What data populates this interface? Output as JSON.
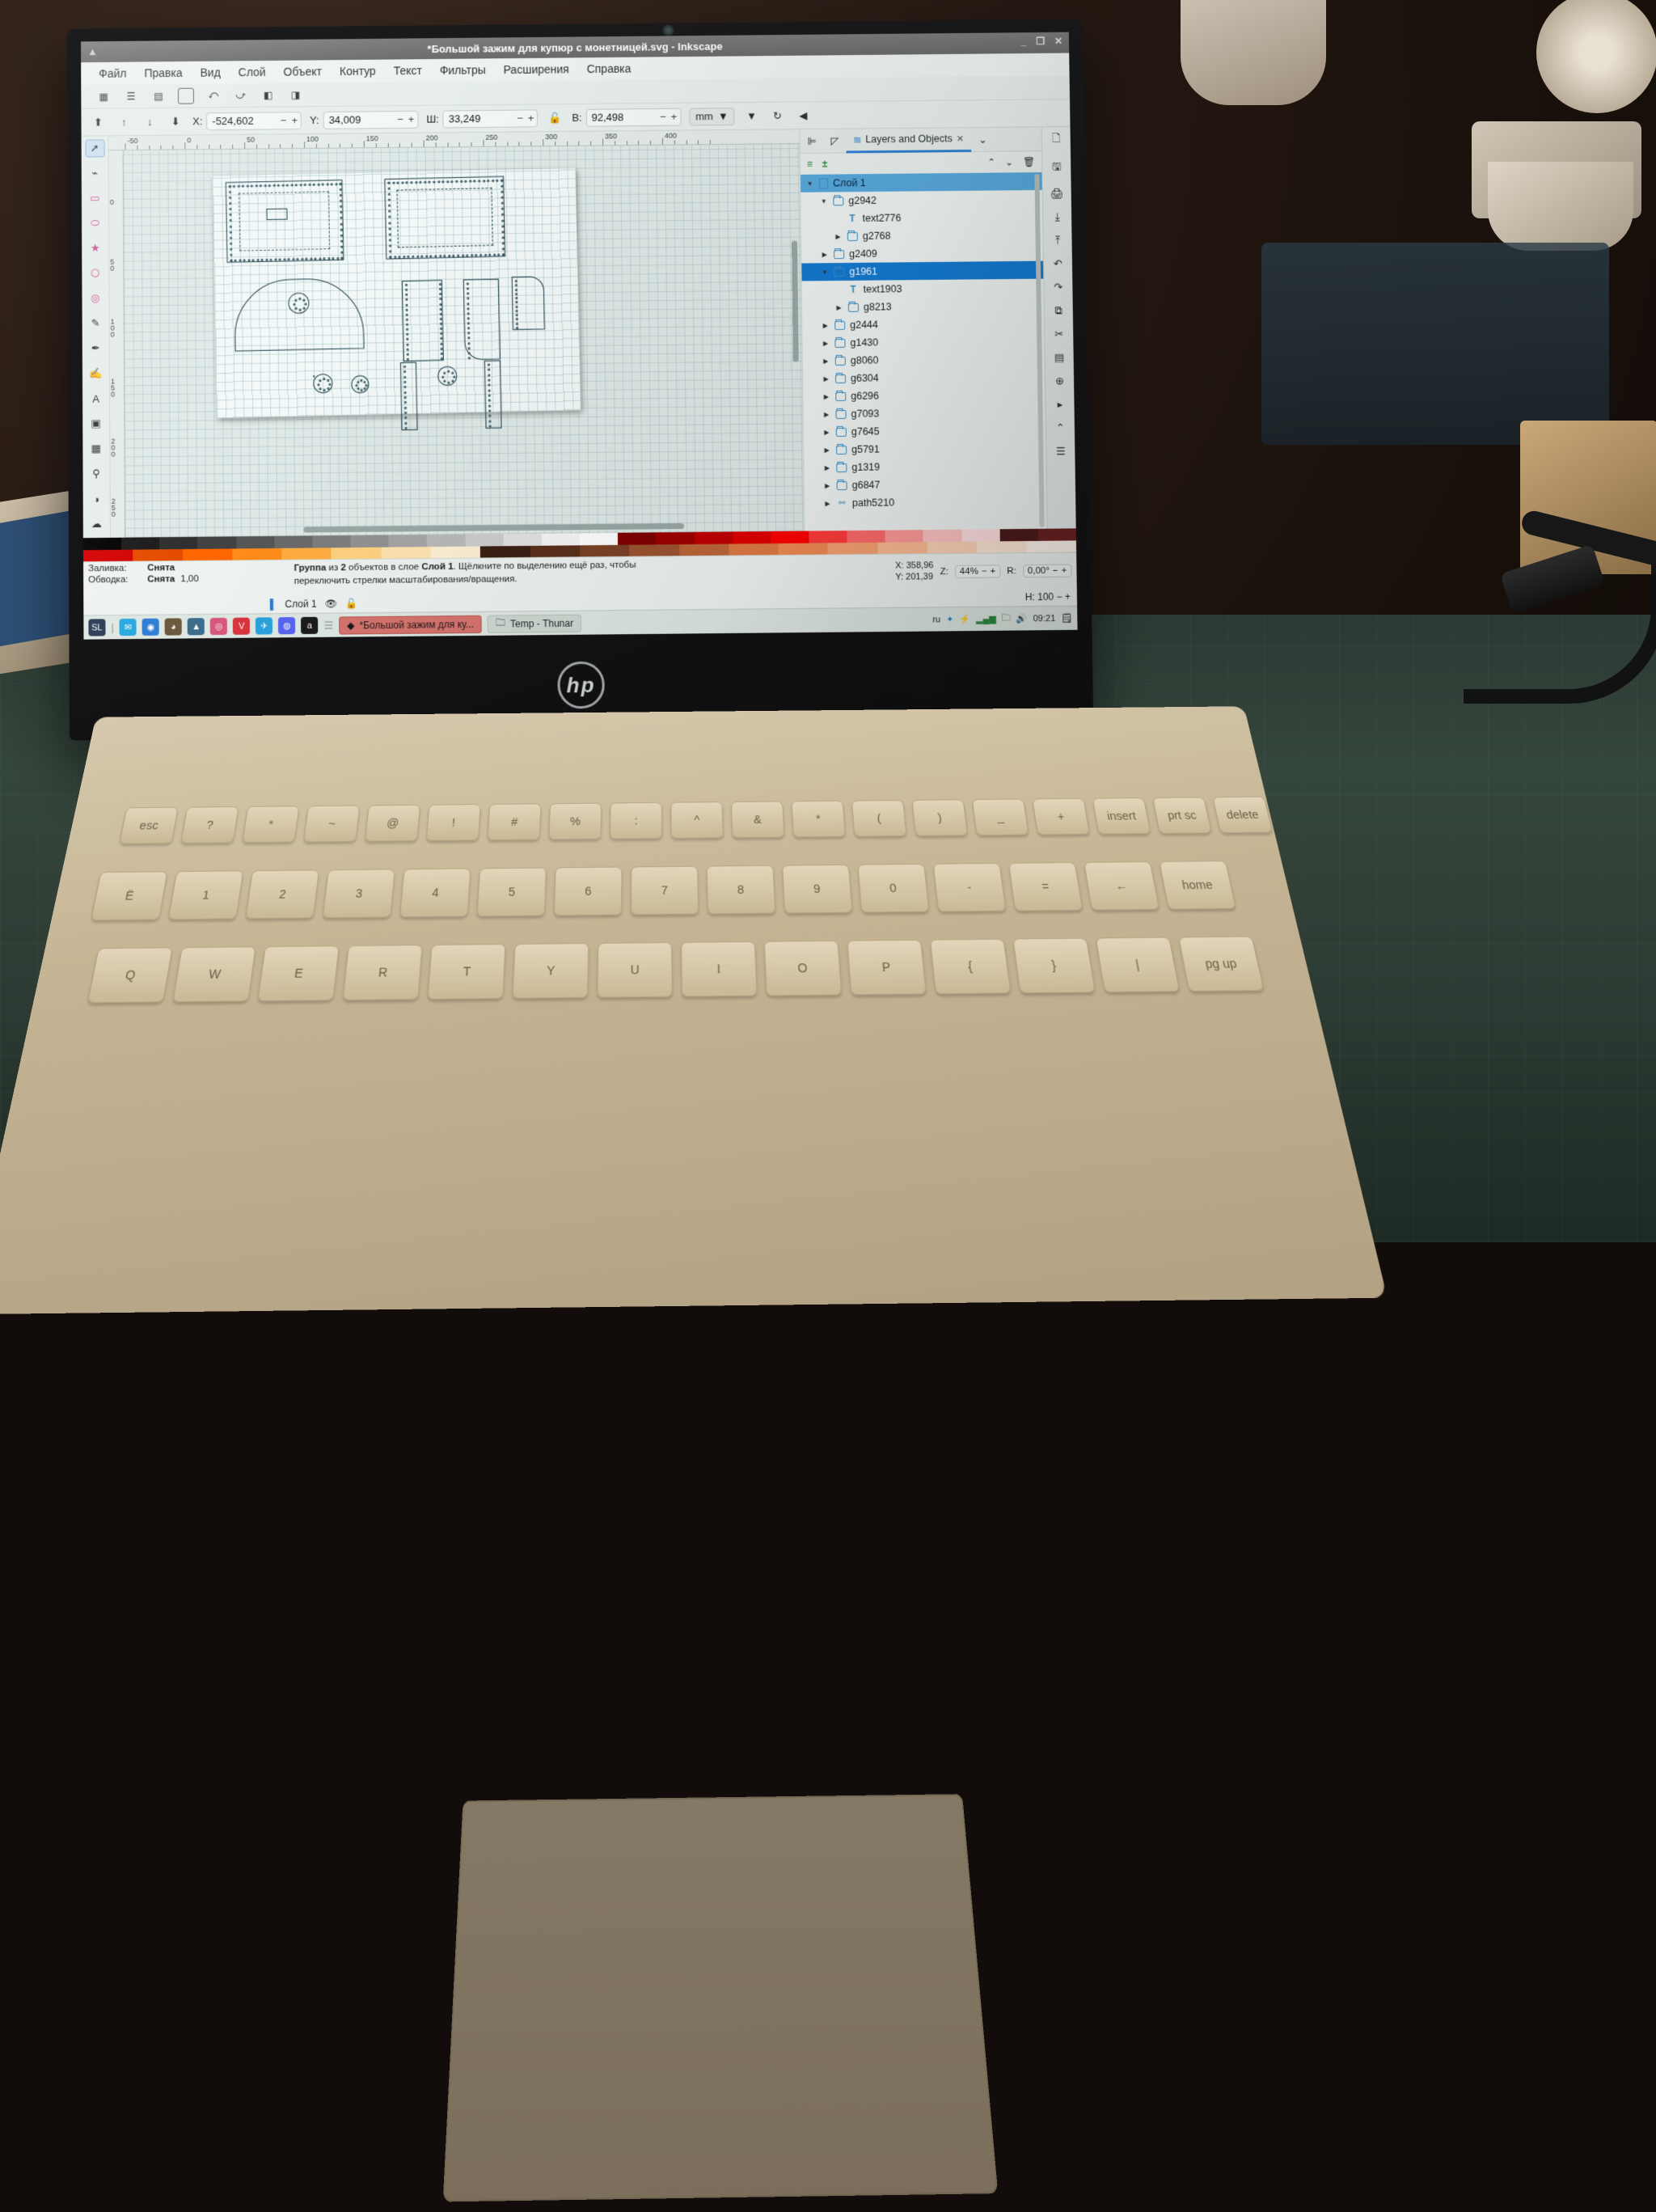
{
  "window": {
    "title": "*Большой зажим для купюр с монетницей.svg - Inkscape",
    "btn_minimize": "_",
    "btn_maximize": "❐",
    "btn_close": "✕",
    "collapse_arrow": "▲"
  },
  "menu": [
    "Файл",
    "Правка",
    "Вид",
    "Слой",
    "Объект",
    "Контур",
    "Текст",
    "Фильтры",
    "Расширения",
    "Справка"
  ],
  "toolbar": {
    "x_label": "X:",
    "x_value": "-524,602",
    "y_label": "Y:",
    "y_value": "34,009",
    "w_label": "Ш:",
    "w_value": "33,249",
    "h_label": "B:",
    "h_value": "92,498",
    "units": "mm",
    "minus": "−",
    "plus": "+",
    "lock_icon": "🔓",
    "overflow_arrow": "▼",
    "rotate_icon": "↻",
    "panel_arrow": "◀"
  },
  "rulers": {
    "h_ticks": [
      "-50",
      "0",
      "50",
      "100",
      "150",
      "200",
      "250",
      "300",
      "350",
      "400"
    ],
    "v_ticks": [
      "0",
      "50",
      "100",
      "150",
      "200",
      "250"
    ]
  },
  "dock": {
    "tabs": [
      {
        "label": "",
        "icon": "align-icon",
        "active": false
      },
      {
        "label": "",
        "icon": "pencil-icon",
        "active": false
      },
      {
        "label": "Layers and Objects",
        "icon": "layers-icon",
        "active": true,
        "close": "✕"
      }
    ],
    "chevron": "⌄",
    "tools": {
      "new_layer_icon": "≡",
      "add_layer_icon": "±",
      "move_up_icon": "⌃",
      "move_down_icon": "⌄",
      "delete_icon": "🗑"
    },
    "tree": [
      {
        "label": "Слой 1",
        "depth": 0,
        "type": "layer",
        "expanded": true,
        "selected": "light"
      },
      {
        "label": "g2942",
        "depth": 1,
        "type": "group",
        "expanded": true,
        "selected": "none"
      },
      {
        "label": "text2776",
        "depth": 2,
        "type": "text",
        "expanded": null,
        "selected": "none"
      },
      {
        "label": "g2768",
        "depth": 2,
        "type": "group",
        "expanded": false,
        "selected": "none"
      },
      {
        "label": "g2409",
        "depth": 1,
        "type": "group",
        "expanded": false,
        "selected": "none"
      },
      {
        "label": "g1961",
        "depth": 1,
        "type": "group",
        "expanded": true,
        "selected": "strong"
      },
      {
        "label": "text1903",
        "depth": 2,
        "type": "text",
        "expanded": null,
        "selected": "none"
      },
      {
        "label": "g8213",
        "depth": 2,
        "type": "group",
        "expanded": false,
        "selected": "none"
      },
      {
        "label": "g2444",
        "depth": 1,
        "type": "group",
        "expanded": false,
        "selected": "none"
      },
      {
        "label": "g1430",
        "depth": 1,
        "type": "group",
        "expanded": false,
        "selected": "none"
      },
      {
        "label": "g8060",
        "depth": 1,
        "type": "group",
        "expanded": false,
        "selected": "none"
      },
      {
        "label": "g6304",
        "depth": 1,
        "type": "group",
        "expanded": false,
        "selected": "none"
      },
      {
        "label": "g6296",
        "depth": 1,
        "type": "group",
        "expanded": false,
        "selected": "none"
      },
      {
        "label": "g7093",
        "depth": 1,
        "type": "group",
        "expanded": false,
        "selected": "none"
      },
      {
        "label": "g7645",
        "depth": 1,
        "type": "group",
        "expanded": false,
        "selected": "none"
      },
      {
        "label": "g5791",
        "depth": 1,
        "type": "group",
        "expanded": false,
        "selected": "none"
      },
      {
        "label": "g1319",
        "depth": 1,
        "type": "group",
        "expanded": false,
        "selected": "none"
      },
      {
        "label": "g6847",
        "depth": 1,
        "type": "group",
        "expanded": false,
        "selected": "none"
      },
      {
        "label": "path5210",
        "depth": 1,
        "type": "path",
        "expanded": false,
        "selected": "none"
      }
    ]
  },
  "status": {
    "fill_label": "Заливка:",
    "fill_value": "Снята",
    "stroke_label": "Обводка:",
    "stroke_value": "Снята",
    "stroke_width": "1,00",
    "opacity_label": "H:",
    "opacity_value": "100",
    "minus": "−",
    "plus": "+",
    "layer_name": "Слой 1",
    "eye_icon": "👁",
    "lock_icon": "🔓",
    "message_line1_bold1": "Группа",
    "message_line1_mid": " из ",
    "message_line1_bold2": "2",
    "message_line1_rest": " объектов в слое ",
    "message_line1_bold3": "Слой 1",
    "message_line1_tail": ". Щёлкните по выделению ещё раз, чтобы",
    "message_line2": "переключить стрелки масштабирования/вращения.",
    "pointer_x_label": "X:",
    "pointer_x": "358,96",
    "pointer_y_label": "Y:",
    "pointer_y": "201,39",
    "zoom_label": "Z:",
    "zoom_value": "44%",
    "rotate_label": "R:",
    "rotate_value": "0,00°"
  },
  "tray": {
    "keyboard_layout": "ru",
    "bluetooth_icon": "bluetooth-icon",
    "battery_icon": "battery-icon",
    "network_icon": "network-icon",
    "archive_icon": "archive-icon",
    "volume_icon": "volume-icon",
    "clock": "09:21",
    "clipboard_icon": "clipboard-icon"
  },
  "taskbar": {
    "launchers": [
      "SL",
      "chat-icon",
      "browser-icon",
      "owl-icon",
      "hat-icon",
      "firefox-icon",
      "vivaldi-icon",
      "telegram-icon",
      "discord-icon",
      "amazon-icon"
    ],
    "tasks": [
      {
        "label": "*Большой зажим для ку...",
        "active": true,
        "icon": "inkscape-icon"
      },
      {
        "label": "Temp - Thunar",
        "active": false,
        "icon": "folder-icon"
      }
    ]
  },
  "laptop": {
    "brand": "hp",
    "keys_row1": [
      "esc",
      "?",
      "*",
      "~",
      "@",
      "!",
      "#",
      "%",
      ":",
      "^",
      "&",
      "*",
      "(",
      ")",
      "_",
      "+",
      "insert",
      "prt sc",
      "delete"
    ],
    "keys_row2": [
      "Ё",
      "1",
      "2",
      "3",
      "4",
      "5",
      "6",
      "7",
      "8",
      "9",
      "0",
      "-",
      "=",
      "←",
      "home"
    ],
    "keys_row3": [
      "Q",
      "W",
      "E",
      "R",
      "T",
      "Y",
      "U",
      "I",
      "O",
      "P",
      "{",
      "}",
      "|",
      "pg up"
    ]
  },
  "colors": {
    "accent": "#1479d0",
    "tab_underline": "#2d7fd1",
    "selection_light": "#57a8dc",
    "task_active": "#d7746e"
  },
  "palette_row1": [
    "#000000",
    "#1a1a1a",
    "#2e2e2e",
    "#424242",
    "#565656",
    "#6a6a6a",
    "#7e7e7e",
    "#929292",
    "#a6a6a6",
    "#bababa",
    "#cecece",
    "#e2e2e2",
    "#f6f6f6",
    "#ffffff",
    "#800000",
    "#a00000",
    "#c00000",
    "#e00000",
    "#ff0000",
    "#ff3b3b",
    "#ff6b6b",
    "#ff9a9a",
    "#ffc4c4",
    "#ffe0e0",
    "#4d1a1a",
    "#6b2222"
  ],
  "palette_row2": [
    "#d40000",
    "#e54b00",
    "#ff6600",
    "#ff8c1a",
    "#ffae42",
    "#ffd27f",
    "#ffe3b0",
    "#fff0d4",
    "#3a1f14",
    "#5a2f1c",
    "#7b4226",
    "#9c5430",
    "#bd663a",
    "#de7844",
    "#f08a52",
    "#f7a272",
    "#fcbb95",
    "#fed3b7",
    "#ffe7d6",
    "#fff4ec"
  ]
}
